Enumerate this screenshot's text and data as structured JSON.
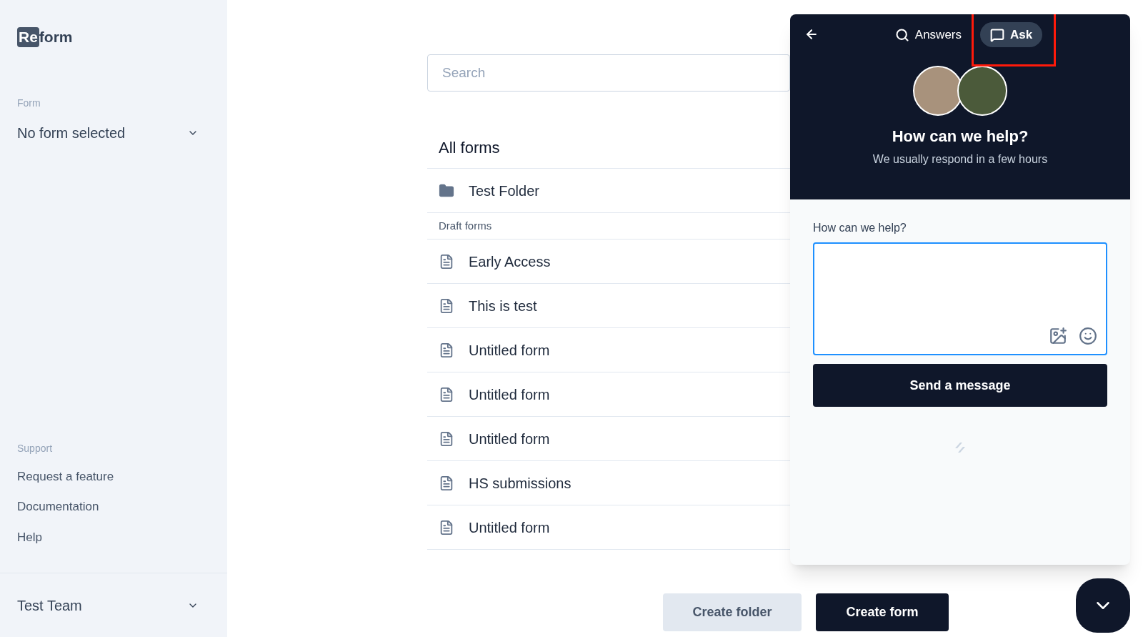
{
  "sidebar": {
    "logo": {
      "mark": "Re",
      "word": "form"
    },
    "form_label": "Form",
    "form_select": "No form selected",
    "support_label": "Support",
    "support_links": [
      "Request a feature",
      "Documentation",
      "Help"
    ],
    "team": "Test Team"
  },
  "main": {
    "search": {
      "placeholder": "Search"
    },
    "heading": "All forms",
    "folders": [
      {
        "name": "Test Folder"
      }
    ],
    "section_label": "Draft forms",
    "forms": [
      {
        "name": "Early Access"
      },
      {
        "name": "This is test"
      },
      {
        "name": "Untitled form"
      },
      {
        "name": "Untitled form"
      },
      {
        "name": "Untitled form"
      },
      {
        "name": "HS submissions"
      },
      {
        "name": "Untitled form"
      }
    ],
    "buttons": [
      {
        "label": "Create folder",
        "kind": "secondary"
      },
      {
        "label": "Create form",
        "kind": "primary"
      }
    ]
  },
  "chat": {
    "tabs": [
      {
        "label": "Answers",
        "kind": "search",
        "selected": false,
        "highlighted": false
      },
      {
        "label": "Ask",
        "kind": "ask",
        "selected": true,
        "highlighted": true
      }
    ],
    "title": "How can we help?",
    "subtitle": "We usually respond in a few hours",
    "field_label": "How can we help?",
    "send": "Send a message"
  }
}
